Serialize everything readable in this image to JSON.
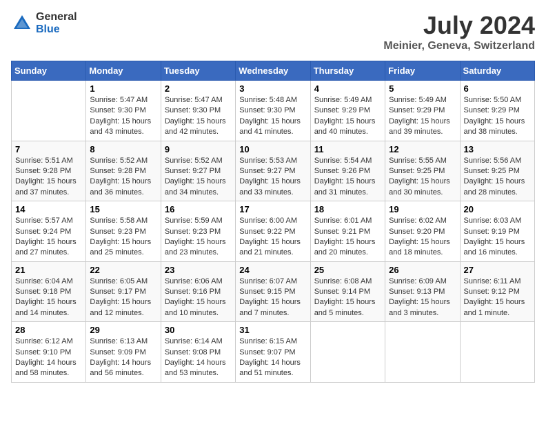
{
  "header": {
    "logo_general": "General",
    "logo_blue": "Blue",
    "month_year": "July 2024",
    "location": "Meinier, Geneva, Switzerland"
  },
  "days_of_week": [
    "Sunday",
    "Monday",
    "Tuesday",
    "Wednesday",
    "Thursday",
    "Friday",
    "Saturday"
  ],
  "weeks": [
    [
      {
        "day": "",
        "content": ""
      },
      {
        "day": "1",
        "content": "Sunrise: 5:47 AM\nSunset: 9:30 PM\nDaylight: 15 hours\nand 43 minutes."
      },
      {
        "day": "2",
        "content": "Sunrise: 5:47 AM\nSunset: 9:30 PM\nDaylight: 15 hours\nand 42 minutes."
      },
      {
        "day": "3",
        "content": "Sunrise: 5:48 AM\nSunset: 9:30 PM\nDaylight: 15 hours\nand 41 minutes."
      },
      {
        "day": "4",
        "content": "Sunrise: 5:49 AM\nSunset: 9:29 PM\nDaylight: 15 hours\nand 40 minutes."
      },
      {
        "day": "5",
        "content": "Sunrise: 5:49 AM\nSunset: 9:29 PM\nDaylight: 15 hours\nand 39 minutes."
      },
      {
        "day": "6",
        "content": "Sunrise: 5:50 AM\nSunset: 9:29 PM\nDaylight: 15 hours\nand 38 minutes."
      }
    ],
    [
      {
        "day": "7",
        "content": "Sunrise: 5:51 AM\nSunset: 9:28 PM\nDaylight: 15 hours\nand 37 minutes."
      },
      {
        "day": "8",
        "content": "Sunrise: 5:52 AM\nSunset: 9:28 PM\nDaylight: 15 hours\nand 36 minutes."
      },
      {
        "day": "9",
        "content": "Sunrise: 5:52 AM\nSunset: 9:27 PM\nDaylight: 15 hours\nand 34 minutes."
      },
      {
        "day": "10",
        "content": "Sunrise: 5:53 AM\nSunset: 9:27 PM\nDaylight: 15 hours\nand 33 minutes."
      },
      {
        "day": "11",
        "content": "Sunrise: 5:54 AM\nSunset: 9:26 PM\nDaylight: 15 hours\nand 31 minutes."
      },
      {
        "day": "12",
        "content": "Sunrise: 5:55 AM\nSunset: 9:25 PM\nDaylight: 15 hours\nand 30 minutes."
      },
      {
        "day": "13",
        "content": "Sunrise: 5:56 AM\nSunset: 9:25 PM\nDaylight: 15 hours\nand 28 minutes."
      }
    ],
    [
      {
        "day": "14",
        "content": "Sunrise: 5:57 AM\nSunset: 9:24 PM\nDaylight: 15 hours\nand 27 minutes."
      },
      {
        "day": "15",
        "content": "Sunrise: 5:58 AM\nSunset: 9:23 PM\nDaylight: 15 hours\nand 25 minutes."
      },
      {
        "day": "16",
        "content": "Sunrise: 5:59 AM\nSunset: 9:23 PM\nDaylight: 15 hours\nand 23 minutes."
      },
      {
        "day": "17",
        "content": "Sunrise: 6:00 AM\nSunset: 9:22 PM\nDaylight: 15 hours\nand 21 minutes."
      },
      {
        "day": "18",
        "content": "Sunrise: 6:01 AM\nSunset: 9:21 PM\nDaylight: 15 hours\nand 20 minutes."
      },
      {
        "day": "19",
        "content": "Sunrise: 6:02 AM\nSunset: 9:20 PM\nDaylight: 15 hours\nand 18 minutes."
      },
      {
        "day": "20",
        "content": "Sunrise: 6:03 AM\nSunset: 9:19 PM\nDaylight: 15 hours\nand 16 minutes."
      }
    ],
    [
      {
        "day": "21",
        "content": "Sunrise: 6:04 AM\nSunset: 9:18 PM\nDaylight: 15 hours\nand 14 minutes."
      },
      {
        "day": "22",
        "content": "Sunrise: 6:05 AM\nSunset: 9:17 PM\nDaylight: 15 hours\nand 12 minutes."
      },
      {
        "day": "23",
        "content": "Sunrise: 6:06 AM\nSunset: 9:16 PM\nDaylight: 15 hours\nand 10 minutes."
      },
      {
        "day": "24",
        "content": "Sunrise: 6:07 AM\nSunset: 9:15 PM\nDaylight: 15 hours\nand 7 minutes."
      },
      {
        "day": "25",
        "content": "Sunrise: 6:08 AM\nSunset: 9:14 PM\nDaylight: 15 hours\nand 5 minutes."
      },
      {
        "day": "26",
        "content": "Sunrise: 6:09 AM\nSunset: 9:13 PM\nDaylight: 15 hours\nand 3 minutes."
      },
      {
        "day": "27",
        "content": "Sunrise: 6:11 AM\nSunset: 9:12 PM\nDaylight: 15 hours\nand 1 minute."
      }
    ],
    [
      {
        "day": "28",
        "content": "Sunrise: 6:12 AM\nSunset: 9:10 PM\nDaylight: 14 hours\nand 58 minutes."
      },
      {
        "day": "29",
        "content": "Sunrise: 6:13 AM\nSunset: 9:09 PM\nDaylight: 14 hours\nand 56 minutes."
      },
      {
        "day": "30",
        "content": "Sunrise: 6:14 AM\nSunset: 9:08 PM\nDaylight: 14 hours\nand 53 minutes."
      },
      {
        "day": "31",
        "content": "Sunrise: 6:15 AM\nSunset: 9:07 PM\nDaylight: 14 hours\nand 51 minutes."
      },
      {
        "day": "",
        "content": ""
      },
      {
        "day": "",
        "content": ""
      },
      {
        "day": "",
        "content": ""
      }
    ]
  ]
}
